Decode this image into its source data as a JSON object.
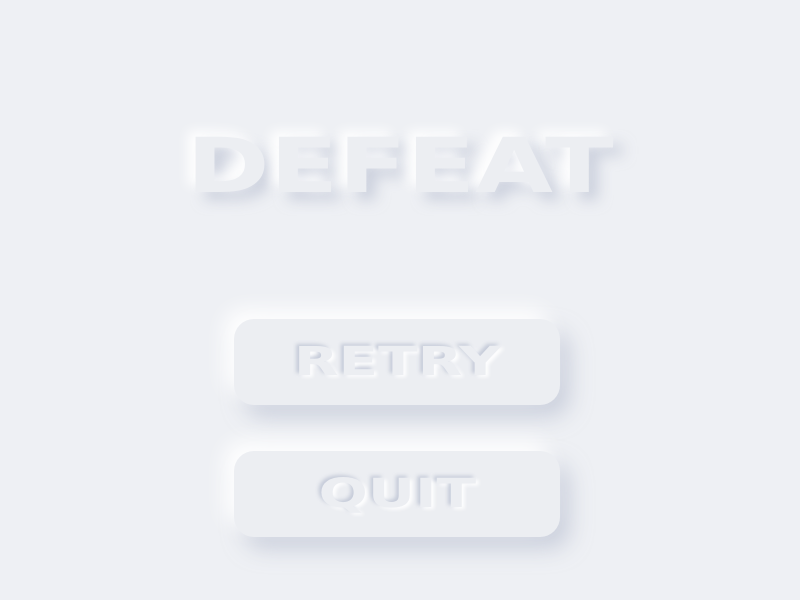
{
  "screen": {
    "title": "DEFEAT",
    "buttons": {
      "retry_label": "RETRY",
      "quit_label": "QUIT"
    }
  },
  "colors": {
    "background": "#eef0f4",
    "surface": "#eceef2",
    "shadow_dark": "#aeb6ca",
    "shadow_light": "#ffffff"
  }
}
